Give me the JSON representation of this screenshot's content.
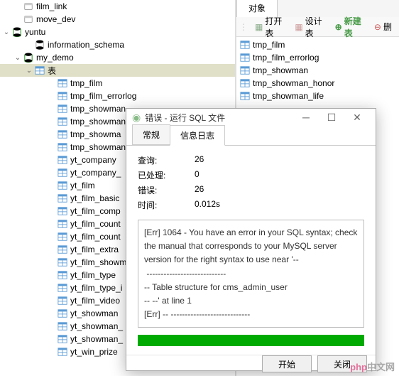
{
  "tree": {
    "items": [
      {
        "level": 1,
        "icon": "link",
        "label": "film_link",
        "expand": ""
      },
      {
        "level": 1,
        "icon": "link",
        "label": "move_dev",
        "expand": ""
      },
      {
        "level": 0,
        "icon": "db-active",
        "label": "yuntu",
        "expand": "v"
      },
      {
        "level": 2,
        "icon": "schema",
        "label": "information_schema",
        "expand": ""
      },
      {
        "level": 1,
        "icon": "schema-active",
        "label": "my_demo",
        "expand": "v"
      },
      {
        "level": 2,
        "icon": "tables",
        "label": "表",
        "expand": "v",
        "selected": true
      },
      {
        "level": 4,
        "icon": "table",
        "label": "tmp_film",
        "expand": ""
      },
      {
        "level": 4,
        "icon": "table",
        "label": "tmp_film_errorlog",
        "expand": ""
      },
      {
        "level": 4,
        "icon": "table",
        "label": "tmp_showman",
        "expand": ""
      },
      {
        "level": 4,
        "icon": "table",
        "label": "tmp_showman",
        "expand": ""
      },
      {
        "level": 4,
        "icon": "table",
        "label": "tmp_showma",
        "expand": ""
      },
      {
        "level": 4,
        "icon": "table",
        "label": "tmp_showman",
        "expand": ""
      },
      {
        "level": 4,
        "icon": "table",
        "label": "yt_company",
        "expand": ""
      },
      {
        "level": 4,
        "icon": "table",
        "label": "yt_company_",
        "expand": ""
      },
      {
        "level": 4,
        "icon": "table",
        "label": "yt_film",
        "expand": ""
      },
      {
        "level": 4,
        "icon": "table",
        "label": "yt_film_basic",
        "expand": ""
      },
      {
        "level": 4,
        "icon": "table",
        "label": "yt_film_comp",
        "expand": ""
      },
      {
        "level": 4,
        "icon": "table",
        "label": "yt_film_count",
        "expand": ""
      },
      {
        "level": 4,
        "icon": "table",
        "label": "yt_film_count",
        "expand": ""
      },
      {
        "level": 4,
        "icon": "table",
        "label": "yt_film_extra",
        "expand": ""
      },
      {
        "level": 4,
        "icon": "table",
        "label": "yt_film_showm",
        "expand": ""
      },
      {
        "level": 4,
        "icon": "table",
        "label": "yt_film_type",
        "expand": ""
      },
      {
        "level": 4,
        "icon": "table",
        "label": "yt_film_type_i",
        "expand": ""
      },
      {
        "level": 4,
        "icon": "table",
        "label": "yt_film_video",
        "expand": ""
      },
      {
        "level": 4,
        "icon": "table",
        "label": "yt_showman",
        "expand": ""
      },
      {
        "level": 4,
        "icon": "table",
        "label": "yt_showman_",
        "expand": ""
      },
      {
        "level": 4,
        "icon": "table",
        "label": "yt_showman_",
        "expand": ""
      },
      {
        "level": 4,
        "icon": "table",
        "label": "yt_win_prize",
        "expand": ""
      }
    ]
  },
  "right": {
    "tab": "对象",
    "toolbar": {
      "open": "打开表",
      "design": "设计表",
      "new": "新建表",
      "delete": "删"
    },
    "objects": [
      "tmp_film",
      "tmp_film_errorlog",
      "tmp_showman",
      "tmp_showman_honor",
      "tmp_showman_life"
    ]
  },
  "dialog": {
    "title": "错误 - 运行 SQL 文件",
    "tabs": {
      "general": "常规",
      "info": "信息日志"
    },
    "stats": {
      "query_label": "查询:",
      "query_val": "26",
      "processed_label": "已处理:",
      "processed_val": "0",
      "error_label": "错误:",
      "error_val": "26",
      "time_label": "时间:",
      "time_val": "0.012s"
    },
    "error_text": "[Err] 1064 - You have an error in your SQL syntax; check the manual that corresponds to your MySQL server version for the right syntax to use near '--\n ----------------------------\n-- Table structure for cms_admin_user\n-- --' at line 1\n[Err] -- ----------------------------",
    "buttons": {
      "start": "开始",
      "close": "关闭"
    }
  },
  "watermark": {
    "php": "php",
    "rest": "中文网"
  }
}
